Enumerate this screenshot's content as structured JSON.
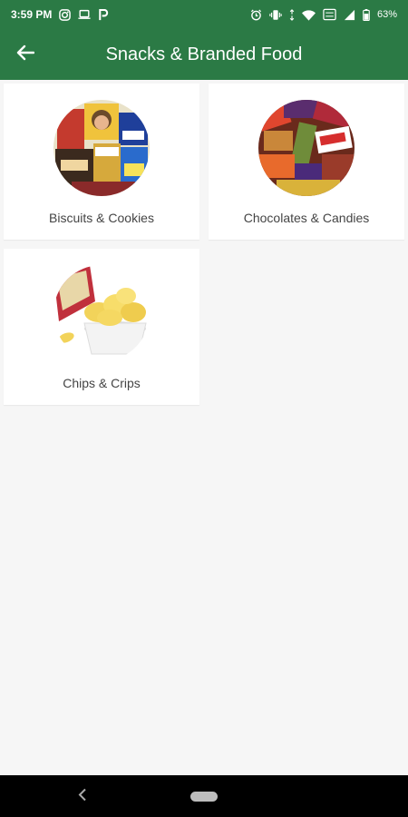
{
  "status_bar": {
    "time": "3:59 PM",
    "battery": "63%"
  },
  "app_bar": {
    "title": "Snacks & Branded Food",
    "back_icon": "arrow-left-icon"
  },
  "categories": [
    {
      "label": "Biscuits & Cookies"
    },
    {
      "label": "Chocolates & Candies"
    },
    {
      "label": "Chips & Crips"
    }
  ],
  "colors": {
    "primary": "#2b7a45",
    "background": "#f6f6f6",
    "card": "#ffffff",
    "label_text": "#444444"
  }
}
